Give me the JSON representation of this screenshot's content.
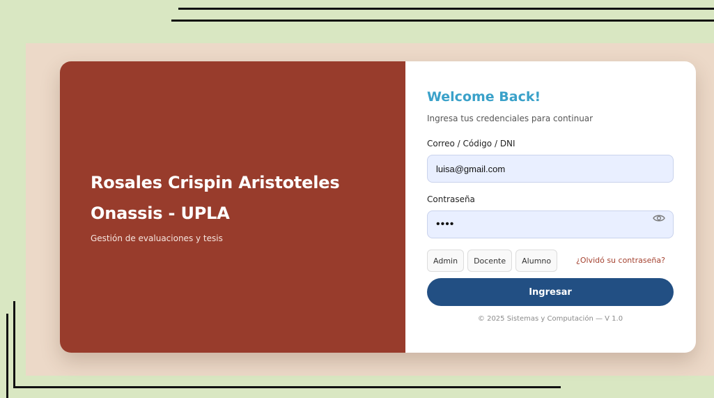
{
  "brand": {
    "title": "Rosales Crispin Aristoteles Onassis - UPLA",
    "subtitle": "Gestión de evaluaciones y tesis"
  },
  "login": {
    "heading": "Welcome Back!",
    "lead": "Ingresa tus credenciales para continuar",
    "user_label": "Correo / Código / DNI",
    "user_value": "luisa@gmail.com",
    "password_label": "Contraseña",
    "password_value": "1234",
    "show_password_icon": "eye-icon",
    "roles": [
      {
        "label": "Admin"
      },
      {
        "label": "Docente"
      },
      {
        "label": "Alumno"
      }
    ],
    "forgot_label": "¿Olvidó su contraseña?",
    "submit_label": "Ingresar",
    "footer": "© 2025 Sistemas y Computación — V 1.0"
  },
  "colors": {
    "background": "#d9e7c2",
    "frame": "#ecd9c8",
    "brand_panel": "#983c2c",
    "heading_accent": "#3aa1c9",
    "input_fill": "#e9efff",
    "submit_button": "#224f83",
    "forgot_link": "#a4412f"
  }
}
